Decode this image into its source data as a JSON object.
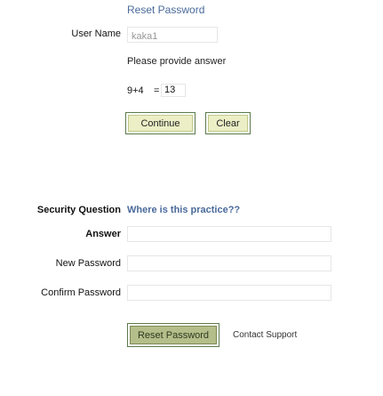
{
  "title": "Reset Password",
  "username": {
    "label": "User Name",
    "value": "kaka1"
  },
  "instruction": "Please provide answer",
  "captcha": {
    "question": "9+4",
    "equals": "=",
    "answer": "13"
  },
  "buttons": {
    "continue": "Continue",
    "clear": "Clear",
    "reset": "Reset Password"
  },
  "security_question": {
    "label": "Security Question",
    "value": "Where is this practice??"
  },
  "answer": {
    "label": "Answer",
    "value": ""
  },
  "new_password": {
    "label": "New Password",
    "value": ""
  },
  "confirm_password": {
    "label": "Confirm Password",
    "value": ""
  },
  "support": "Contact Support",
  "colors": {
    "title": "#4a6a9b",
    "security_value": "#4a6a9b",
    "button_border": "#5c7a4a",
    "button_fill": "#ecefc6",
    "reset_fill": "#b3be8a"
  }
}
